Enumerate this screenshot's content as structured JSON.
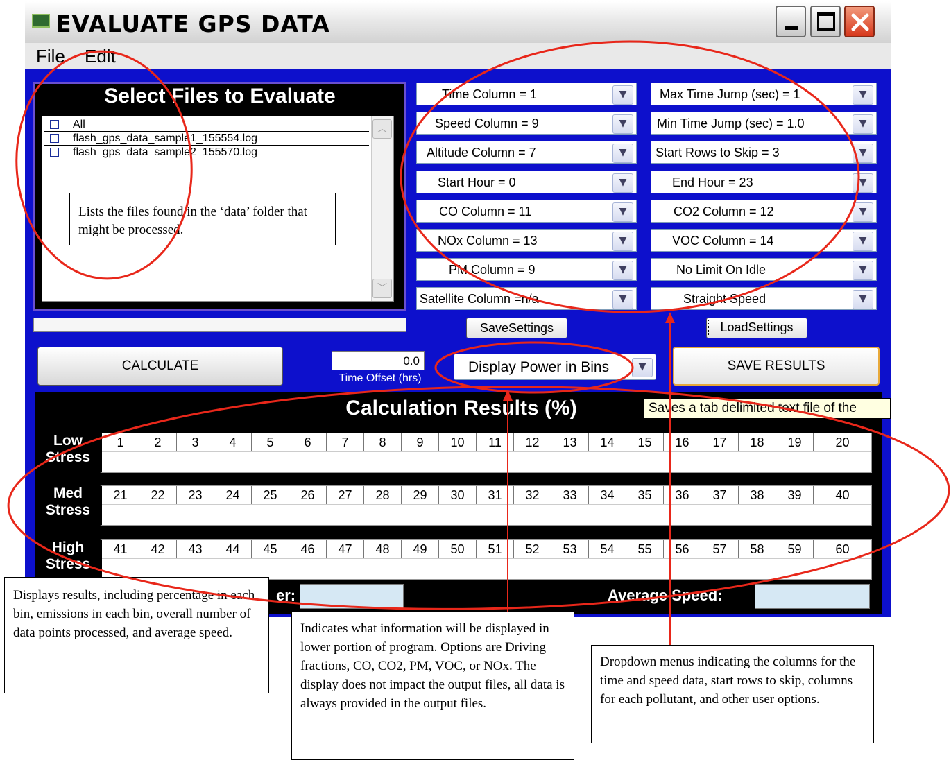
{
  "window": {
    "title": "EVALUATE GPS DATA",
    "controls": [
      "minimize-icon",
      "maximize-icon",
      "close-icon"
    ],
    "menu": [
      "File",
      "Edit"
    ]
  },
  "file_panel": {
    "title": "Select Files to Evaluate",
    "items": [
      {
        "label": "All",
        "checked": false
      },
      {
        "label": "flash_gps_data_sample1_155554.log",
        "checked": false
      },
      {
        "label": "flash_gps_data_sample2_155570.log",
        "checked": false
      }
    ]
  },
  "dropdowns_left": [
    "Time Column = 1",
    "Speed Column = 9",
    "Altitude Column = 7",
    "Start Hour = 0",
    "CO Column = 11",
    "NOx Column = 13",
    "PM Column = 9",
    "Satellite Column =n/a"
  ],
  "dropdowns_right": [
    "Max Time Jump (sec) = 1",
    "Min Time Jump (sec) = 1.0",
    "Start Rows to Skip = 3",
    "End Hour = 23",
    "CO2 Column = 12",
    "VOC Column = 14",
    "No Limit On Idle",
    "Straight Speed"
  ],
  "buttons": {
    "save_settings": "SaveSettings",
    "load_settings": "LoadSettings",
    "calculate": "CALCULATE",
    "save_results": "SAVE RESULTS"
  },
  "time_offset": {
    "value": "0.0",
    "label": "Time Offset (hrs)"
  },
  "display_mode": "Display Power in Bins",
  "results": {
    "title": "Calculation Results (%)",
    "tooltip": "Saves a tab delimited text file of the",
    "rows": [
      {
        "label": "Low Stress",
        "bins": [
          "1",
          "2",
          "3",
          "4",
          "5",
          "6",
          "7",
          "8",
          "9",
          "10",
          "11",
          "12",
          "13",
          "14",
          "15",
          "16",
          "17",
          "18",
          "19",
          "20"
        ]
      },
      {
        "label": "Med Stress",
        "bins": [
          "21",
          "22",
          "23",
          "24",
          "25",
          "26",
          "27",
          "28",
          "29",
          "30",
          "31",
          "32",
          "33",
          "34",
          "35",
          "36",
          "37",
          "38",
          "39",
          "40"
        ]
      },
      {
        "label": "High Stress",
        "bins": [
          "41",
          "42",
          "43",
          "44",
          "45",
          "46",
          "47",
          "48",
          "49",
          "50",
          "51",
          "52",
          "53",
          "54",
          "55",
          "56",
          "57",
          "58",
          "59",
          "60"
        ]
      }
    ],
    "number_label_partial": "er:",
    "average_speed_label": "Average Speed:"
  },
  "annotations": {
    "files": "Lists the files found in the ‘data’ folder that might be processed.",
    "results": "Displays results, including percentage in each bin, emissions in each bin, overall number of data points processed, and average speed.",
    "display": "Indicates what information will be displayed in lower portion of program. Options are Driving fractions, CO, CO2, PM, VOC, or NOx. The display does not impact the output files, all data is always provided in the output files.",
    "dropdowns": "Dropdown menus indicating the columns for the time and speed data, start rows to skip, columns for each pollutant, and other user options."
  },
  "colors": {
    "client": "#0d10cc",
    "annotation_red": "#e8271a",
    "panel": "#000000"
  }
}
